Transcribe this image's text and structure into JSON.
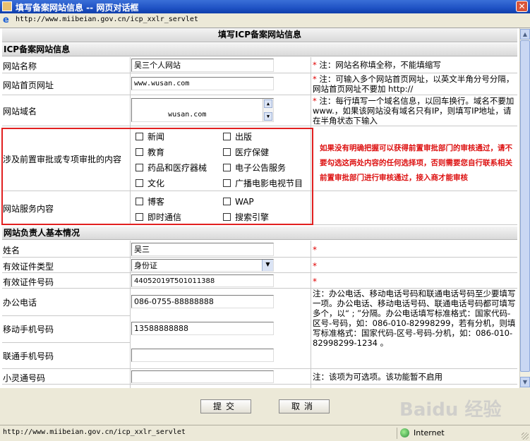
{
  "window": {
    "title": "填写备案网站信息 -- 网页对话框",
    "close_glyph": "✕"
  },
  "address": {
    "url": "http://www.miibeian.gov.cn/icp_xxlr_servlet"
  },
  "form": {
    "title": "填写ICP备案网站信息",
    "section1": "ICP备案网站信息",
    "section2": "网站负责人基本情况",
    "rows": {
      "site_name": {
        "label": "网站名称",
        "value": "吴三个人网站",
        "note": "注：网站名称填全称，不能填缩写"
      },
      "site_url": {
        "label": "网站首页网址",
        "value": "www.wusan.com",
        "note": "注：可输入多个网站首页网址，以英文半角分号分隔，网站首页网址不要加 http://"
      },
      "site_domain": {
        "label": "网站域名",
        "value": "wusan.com",
        "note": "注：每行填写一个域名信息，以回车换行。域名不要加 www.，如果该网站没有域名只有IP，则填写IP地址，请在半角状态下输入"
      },
      "approval": {
        "label": "涉及前置审批或专项审批的内容",
        "options": [
          "新闻",
          "出版",
          "教育",
          "医疗保健",
          "药品和医疗器械",
          "电子公告服务",
          "文化",
          "广播电影电视节目"
        ]
      },
      "service": {
        "label": "网站服务内容",
        "options": [
          "博客",
          "WAP",
          "即时通信",
          "搜索引擎"
        ]
      },
      "red_note": "如果没有明确把握可以获得前置审批部门的审核通过，请不要勾选这两处内容的任何选择项，否则需要您自行联系相关前置审批部门进行审核通过，接入商才能审核",
      "name": {
        "label": "姓名",
        "value": "吴三"
      },
      "id_type": {
        "label": "有效证件类型",
        "value": "身份证"
      },
      "id_number": {
        "label": "有效证件号码",
        "value": "44052019T501011388"
      },
      "office_phone": {
        "label": "办公电话",
        "value": "086-0755-88888888"
      },
      "mobile": {
        "label": "移动手机号码",
        "value": "13588888888"
      },
      "unicom": {
        "label": "联通手机号码",
        "value": ""
      },
      "phs": {
        "label": "小灵通号码",
        "value": "",
        "note": "注：该项为可选项。该功能暂不启用"
      },
      "phone_note": "注：办公电话、移动电话号码和联通电话号码至少要填写一项。办公电话、移动电话号码、联通电话号码都可填写多个，以“ ; ”分隔。办公电话填写标准格式：国家代码-区号-号码，如：086-010-82998299，若有分机，则填写标准格式：国家代码-区号-号码-分机，如：086-010-82998299-1234 。",
      "star": "*"
    }
  },
  "buttons": {
    "submit": "提交",
    "cancel": "取消"
  },
  "status": {
    "url": "http://www.miibeian.gov.cn/icp_xxlr_servlet",
    "zone": "Internet"
  },
  "watermark": "Baidu 经验"
}
